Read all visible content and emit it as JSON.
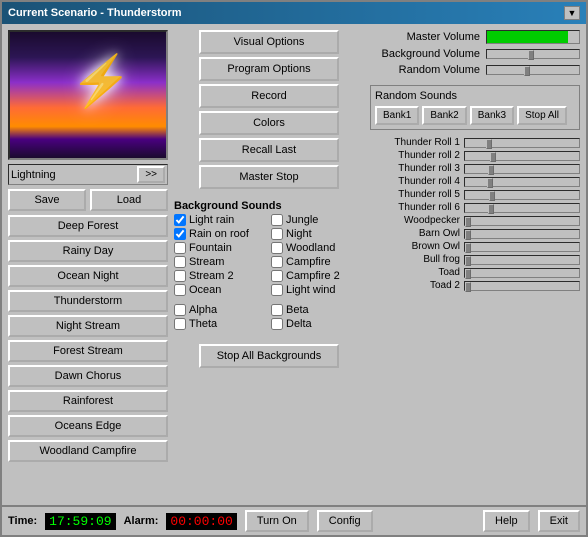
{
  "window": {
    "title": "Current Scenario - Thunderstorm"
  },
  "preview": {
    "label": "Lightning",
    "arrow_label": ">>"
  },
  "scenario_buttons": {
    "save": "Save",
    "load": "Load",
    "items": [
      "Deep Forest",
      "Rainy Day",
      "Ocean Night",
      "Thunderstorm",
      "Night Stream",
      "Forest Stream",
      "Dawn Chorus",
      "Rainforest",
      "Oceans Edge",
      "Woodland Campfire"
    ]
  },
  "main_buttons": [
    "Visual Options",
    "Program Options",
    "Record",
    "Colors",
    "Recall Last",
    "Master Stop"
  ],
  "background_sounds": {
    "title": "Background Sounds",
    "items": [
      {
        "label": "Light rain",
        "checked": true
      },
      {
        "label": "Jungle",
        "checked": false
      },
      {
        "label": "Rain on roof",
        "checked": true
      },
      {
        "label": "Night",
        "checked": false
      },
      {
        "label": "Fountain",
        "checked": false
      },
      {
        "label": "Woodland",
        "checked": false
      },
      {
        "label": "Stream",
        "checked": false
      },
      {
        "label": "Campfire",
        "checked": false
      },
      {
        "label": "Stream 2",
        "checked": false
      },
      {
        "label": "Campfire 2",
        "checked": false
      },
      {
        "label": "Ocean",
        "checked": false
      },
      {
        "label": "Light wind",
        "checked": false
      }
    ],
    "brain_items": [
      {
        "label": "Alpha",
        "checked": false
      },
      {
        "label": "Beta",
        "checked": false
      },
      {
        "label": "Theta",
        "checked": false
      },
      {
        "label": "Delta",
        "checked": false
      }
    ],
    "stop_button": "Stop All Backgrounds"
  },
  "volumes": {
    "master_label": "Master Volume",
    "background_label": "Background Volume",
    "random_label": "Random Volume"
  },
  "random_sounds": {
    "title": "Random Sounds",
    "banks": [
      "Bank1",
      "Bank2",
      "Bank3",
      "Stop All"
    ],
    "sounds": [
      "Thunder Roll 1",
      "Thunder roll 2",
      "Thunder roll 3",
      "Thunder roll 4",
      "Thunder roll 5",
      "Thunder roll 6",
      "Woodpecker",
      "Barn Owl",
      "Brown Owl",
      "Bull frog",
      "Toad",
      "Toad 2"
    ]
  },
  "status_bar": {
    "time_label": "Time:",
    "time_value": "17:59:09",
    "alarm_label": "Alarm:",
    "alarm_value": "00:00:00",
    "turn_on": "Turn On",
    "config": "Config",
    "help": "Help",
    "exit": "Exit"
  }
}
